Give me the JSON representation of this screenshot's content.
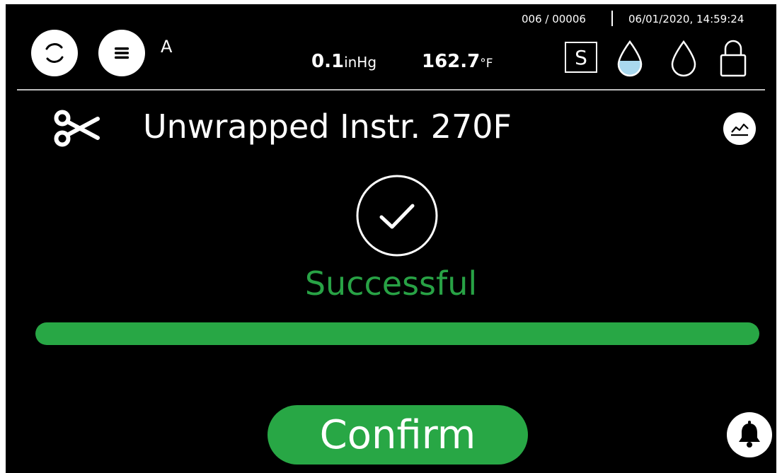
{
  "header": {
    "user": "A",
    "cycle_info": "006 / 00006",
    "datetime": "06/01/2020, 14:59:24",
    "pressure": {
      "value": "0.1",
      "unit": "inHg"
    },
    "temperature": {
      "value": "162.7",
      "unit": "°F"
    },
    "mode_badge": "S"
  },
  "icons": {
    "refresh": "refresh-icon",
    "menu": "menu-icon",
    "water_filled": "water-drop-filled-icon",
    "water_empty": "water-drop-empty-icon",
    "lock": "lock-icon",
    "scissors": "scissors-icon",
    "graph": "graph-icon",
    "check": "check-circle-icon",
    "bell": "bell-icon"
  },
  "program": {
    "title": "Unwrapped Instr. 270F"
  },
  "status": {
    "text": "Successful",
    "progress": 1.0
  },
  "actions": {
    "confirm_label": "Confirm"
  },
  "colors": {
    "background": "#000000",
    "success": "#28a745",
    "water_fill": "#a9d8ee"
  }
}
